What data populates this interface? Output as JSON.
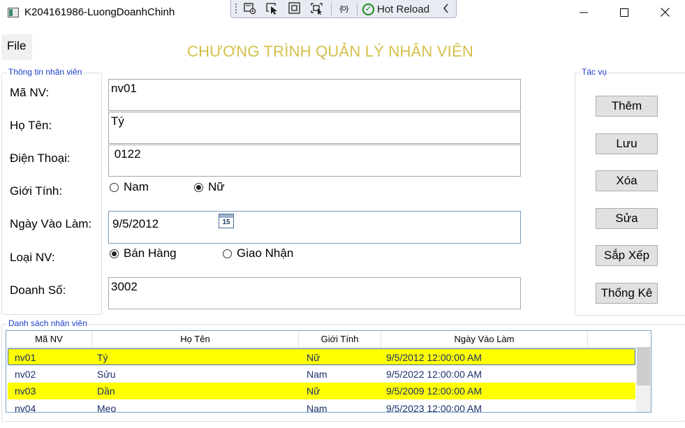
{
  "window": {
    "title": "K204161986-LuongDoanhChinh",
    "minimize_glyph": "—",
    "maximize_glyph": "☐",
    "close_glyph": "✕"
  },
  "hot_reload_toolbar": {
    "label": "Hot Reload",
    "icons": [
      "live-visual-tree-icon",
      "select-element-icon",
      "display-layout-adorners-icon",
      "track-focus-icon",
      "xaml-binding-icon",
      "hot-reload-check-icon",
      "collapse-chevron-icon"
    ]
  },
  "menu": {
    "file_label": "File"
  },
  "main_title": "CHƯƠNG TRÌNH QUẢN LÝ NHÂN VIÊN",
  "info_group": {
    "title": "Thông tin nhân viên",
    "labels": {
      "ma_nv": "Mã NV:",
      "ho_ten": "Họ Tên:",
      "dien_thoai": "Điện Thoại:",
      "gioi_tinh": "Giới Tính:",
      "ngay_vao_lam": "Ngày Vào Làm:",
      "loai_nv": "Loại NV:",
      "doanh_so": "Doanh Số:"
    },
    "values": {
      "ma_nv": "nv01",
      "ho_ten": "Tý",
      "dien_thoai": " 0122",
      "ngay_vao_lam": "9/5/2012",
      "doanh_so": "3002"
    },
    "calendar_day": "15",
    "gender_options": [
      {
        "label": "Nam",
        "checked": false
      },
      {
        "label": "Nữ",
        "checked": true
      }
    ],
    "type_options": [
      {
        "label": "Bán Hàng",
        "checked": true
      },
      {
        "label": "Giao Nhận",
        "checked": false
      }
    ]
  },
  "actions_group": {
    "title": "Tác vụ",
    "buttons": [
      "Thêm",
      "Lưu",
      "Xóa",
      "Sửa",
      "Sắp Xếp",
      "Thống Kê"
    ]
  },
  "list_group": {
    "title": "Danh sách nhân viên",
    "columns": [
      "Mã NV",
      "Họ Tên",
      "Giới Tính",
      "Ngày Vào Làm"
    ],
    "rows": [
      {
        "ma_nv": "nv01",
        "ho_ten": "Tý",
        "gioi_tinh": "Nữ",
        "ngay_vao_lam": "9/5/2012 12:00:00 AM",
        "highlight": true,
        "selected": true
      },
      {
        "ma_nv": "nv02",
        "ho_ten": "Sửu",
        "gioi_tinh": "Nam",
        "ngay_vao_lam": "9/5/2022 12:00:00 AM",
        "highlight": false,
        "selected": false
      },
      {
        "ma_nv": "nv03",
        "ho_ten": "Dần",
        "gioi_tinh": "Nữ",
        "ngay_vao_lam": "9/5/2009 12:00:00 AM",
        "highlight": true,
        "selected": false
      },
      {
        "ma_nv": "nv04",
        "ho_ten": "Meo",
        "gioi_tinh": "Nam",
        "ngay_vao_lam": "9/5/2023 12:00:00 AM",
        "highlight": false,
        "selected": false
      }
    ]
  },
  "colors": {
    "title_gold": "#d4c04a",
    "group_title_blue": "#1a3dc8",
    "row_highlight": "#ffff00",
    "grid_text": "#1b2f6b"
  }
}
